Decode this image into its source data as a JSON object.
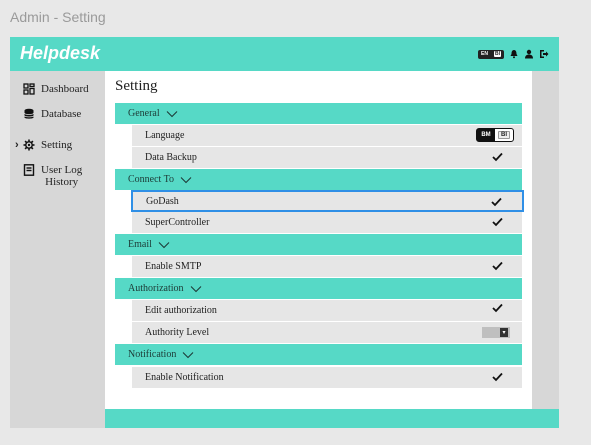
{
  "window": {
    "caption": "Admin - Setting"
  },
  "header": {
    "brand": "Helpdesk",
    "lang_toggle": {
      "left": "EN",
      "right": "BI"
    },
    "icons": [
      "bell-icon",
      "user-icon",
      "logout-icon"
    ]
  },
  "sidebar": {
    "items": [
      {
        "label": "Dashboard",
        "icon": "dashboard-icon"
      },
      {
        "label": "Database",
        "icon": "database-icon"
      },
      {
        "label": "Setting",
        "icon": "gear-icon",
        "active": true
      },
      {
        "label": "User Log",
        "label2": "History",
        "icon": "log-icon"
      }
    ]
  },
  "main": {
    "title": "Setting",
    "sections": {
      "general": {
        "label": "General",
        "rows": {
          "language": "Language",
          "data_backup": "Data Backup"
        }
      },
      "connect": {
        "label": "Connect To",
        "rows": {
          "godash": "GoDash",
          "supercontroller": "SuperController"
        }
      },
      "email": {
        "label": "Email",
        "rows": {
          "smtp": "Enable SMTP"
        }
      },
      "authorization": {
        "label": "Authorization",
        "rows": {
          "edit": "Edit authorization",
          "level": "Authority Level"
        }
      },
      "notification": {
        "label": "Notification",
        "rows": {
          "enable": "Enable Notification"
        }
      }
    },
    "language_toggle": {
      "selected": "BM",
      "other": "BI"
    }
  },
  "colors": {
    "accent": "#56d9c6",
    "row_bg": "#e6e6e6",
    "selection": "#2f8fe6"
  }
}
